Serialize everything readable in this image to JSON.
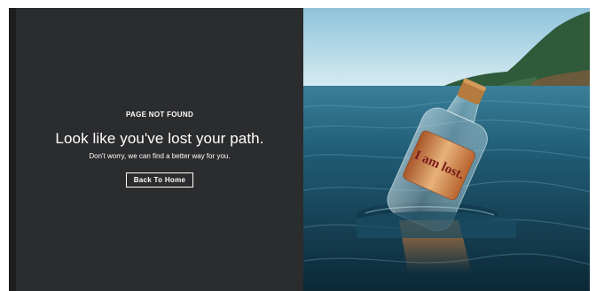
{
  "page": {
    "eyebrow": "PAGE NOT FOUND",
    "headline": "Look like you've lost your path.",
    "subtext": "Don't worry, we can find a better way for you.",
    "home_button_label": "Back To Home"
  },
  "image": {
    "subject": "message-in-a-bottle",
    "note_text": "I am lost."
  },
  "colors": {
    "panel_background": "#2b2c2e",
    "text": "#ffffff",
    "sea": "#1f5a72",
    "sky": "#b9d8e6"
  }
}
